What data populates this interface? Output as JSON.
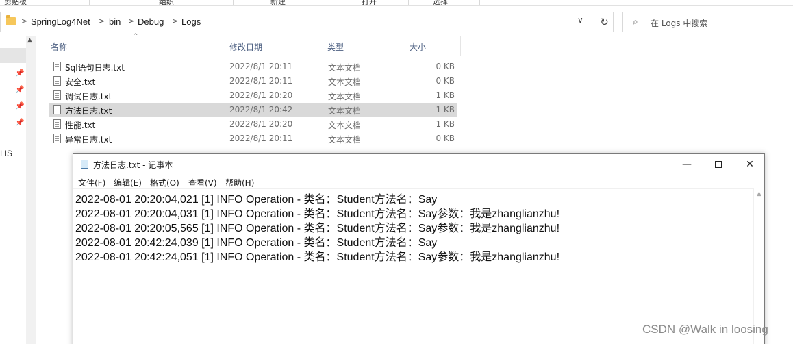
{
  "explorer": {
    "ribbon_fragments": [
      "剪贴板",
      "组织",
      "新建",
      "打开",
      "选择"
    ],
    "breadcrumbs": [
      "SpringLog4Net",
      "bin",
      "Debug",
      "Logs"
    ],
    "crumb_separator": ">",
    "address_dropdown_glyph": "∨",
    "refresh_glyph": "↻",
    "search_glyph": "⌕",
    "search_placeholder": "在 Logs 中搜索",
    "columns": {
      "name": "名称",
      "date": "修改日期",
      "type": "类型",
      "size": "大小"
    },
    "sort_glyph": "^",
    "nav_text": "LIS",
    "pin_glyph": "📌",
    "files": [
      {
        "name": "Sql语句日志.txt",
        "date": "2022/8/1 20:11",
        "type": "文本文档",
        "size": "0 KB",
        "selected": false
      },
      {
        "name": "安全.txt",
        "date": "2022/8/1 20:11",
        "type": "文本文档",
        "size": "0 KB",
        "selected": false
      },
      {
        "name": "调试日志.txt",
        "date": "2022/8/1 20:20",
        "type": "文本文档",
        "size": "1 KB",
        "selected": false
      },
      {
        "name": "方法日志.txt",
        "date": "2022/8/1 20:42",
        "type": "文本文档",
        "size": "1 KB",
        "selected": true
      },
      {
        "name": "性能.txt",
        "date": "2022/8/1 20:20",
        "type": "文本文档",
        "size": "1 KB",
        "selected": false
      },
      {
        "name": "异常日志.txt",
        "date": "2022/8/1 20:11",
        "type": "文本文档",
        "size": "0 KB",
        "selected": false
      }
    ]
  },
  "notepad": {
    "title": "方法日志.txt - 记事本",
    "min_glyph": "—",
    "close_glyph": "✕",
    "menus": [
      "文件(F)",
      "编辑(E)",
      "格式(O)",
      "查看(V)",
      "帮助(H)"
    ],
    "lines": [
      "2022-08-01 20:20:04,021 [1] INFO  Operation - 类名：Student方法名：Say",
      "2022-08-01 20:20:04,031 [1] INFO  Operation - 类名：Student方法名：Say参数：我是zhanglianzhu!",
      "2022-08-01 20:20:05,565 [1] INFO  Operation - 类名：Student方法名：Say参数：我是zhanglianzhu!",
      "2022-08-01 20:42:24,039 [1] INFO  Operation - 类名：Student方法名：Say",
      "2022-08-01 20:42:24,051 [1] INFO  Operation - 类名：Student方法名：Say参数：我是zhanglianzhu!"
    ],
    "scroll_up_glyph": "▲"
  },
  "watermark": "CSDN @Walk in loosing"
}
